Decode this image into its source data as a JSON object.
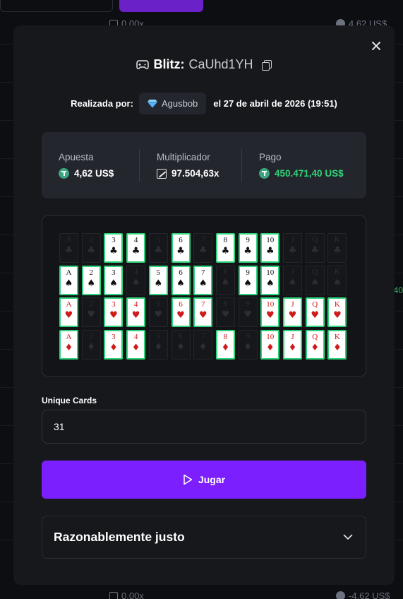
{
  "background": {
    "rows": [
      {
        "multiplier": "0.00x",
        "amount": "4,62 US$"
      },
      {
        "multiplier": "0.00x",
        "amount": "-4,62 US$"
      }
    ],
    "side_value": "40"
  },
  "modal": {
    "game": "Blitz:",
    "bet_id": "CaUhd1YH",
    "made_by_label": "Realizada por:",
    "user": "Agusbob",
    "date": "el 27 de abril de 2026 (19:51)",
    "stats": {
      "bet_label": "Apuesta",
      "bet_value": "4,62 US$",
      "multiplier_label": "Multiplicador",
      "multiplier_value": "97.504,63x",
      "payout_label": "Pago",
      "payout_value": "450.471,40 US$"
    },
    "cards": {
      "ranks": [
        "A",
        "2",
        "3",
        "4",
        "5",
        "6",
        "7",
        "8",
        "9",
        "10",
        "J",
        "Q",
        "K"
      ],
      "rows": [
        {
          "suit": "♣",
          "red": false,
          "active": [
            false,
            false,
            true,
            true,
            false,
            true,
            false,
            true,
            true,
            true,
            false,
            false,
            false
          ]
        },
        {
          "suit": "♠",
          "red": false,
          "active": [
            true,
            true,
            true,
            false,
            true,
            true,
            true,
            false,
            true,
            true,
            false,
            false,
            false
          ]
        },
        {
          "suit": "♥",
          "red": true,
          "active": [
            true,
            false,
            true,
            true,
            false,
            true,
            true,
            false,
            false,
            true,
            true,
            true,
            true
          ]
        },
        {
          "suit": "♦",
          "red": true,
          "active": [
            true,
            false,
            true,
            true,
            false,
            false,
            false,
            true,
            false,
            true,
            true,
            true,
            true
          ]
        }
      ]
    },
    "unique_cards_label": "Unique Cards",
    "unique_cards_value": "31",
    "play_label": "Jugar",
    "fairness_label": "Razonablemente justo"
  }
}
